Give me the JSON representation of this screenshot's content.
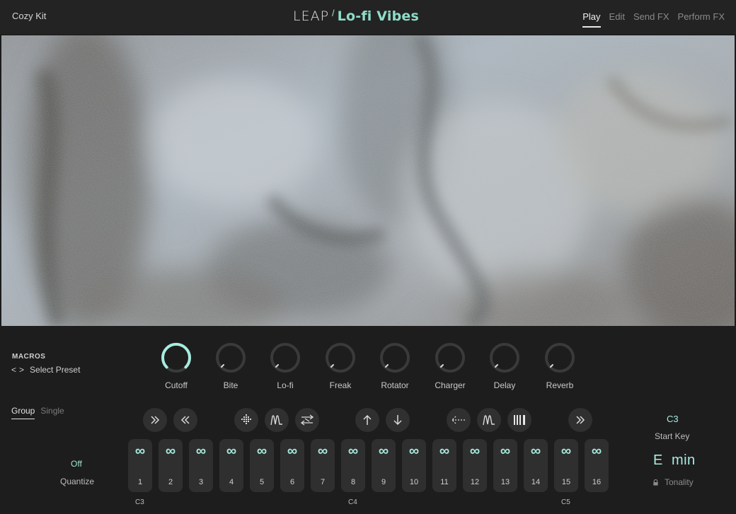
{
  "header": {
    "kit_name": "Cozy Kit",
    "logo_brand": "LEAP",
    "logo_separator": "/",
    "logo_name": "Lo-fi Vibes",
    "tabs": [
      {
        "label": "Play",
        "active": true
      },
      {
        "label": "Edit",
        "active": false
      },
      {
        "label": "Send FX",
        "active": false
      },
      {
        "label": "Perform FX",
        "active": false
      }
    ]
  },
  "artwork": {
    "icon": "blurred-fur-photo"
  },
  "macros": {
    "title": "MACROS",
    "prev_icon": "chevron-left-icon",
    "next_icon": "chevron-right-icon",
    "preset_label": "Select Preset",
    "knobs": [
      {
        "label": "Cutoff",
        "value": 0.9,
        "active": true
      },
      {
        "label": "Bite",
        "value": 0.0,
        "active": false
      },
      {
        "label": "Lo-fi",
        "value": 0.0,
        "active": false
      },
      {
        "label": "Freak",
        "value": 0.0,
        "active": false
      },
      {
        "label": "Rotator",
        "value": 0.0,
        "active": false
      },
      {
        "label": "Charger",
        "value": 0.0,
        "active": false
      },
      {
        "label": "Delay",
        "value": 0.0,
        "active": false
      },
      {
        "label": "Reverb",
        "value": 0.0,
        "active": false
      }
    ]
  },
  "mode_tabs": [
    {
      "label": "Group",
      "active": true
    },
    {
      "label": "Single",
      "active": false
    }
  ],
  "controls": [
    {
      "name": "forward-icon",
      "glyph": "»"
    },
    {
      "name": "reverse-icon",
      "glyph": "«"
    },
    {
      "name": "scatter-icon",
      "glyph": "⬖"
    },
    {
      "name": "envelope-icon",
      "glyph": "ʃ"
    },
    {
      "name": "shuffle-icon",
      "glyph": "⇄"
    },
    {
      "name": "pitch-up-icon",
      "glyph": "↑"
    },
    {
      "name": "pitch-down-icon",
      "glyph": "↓"
    },
    {
      "name": "slice-back-icon",
      "glyph": "⇠"
    },
    {
      "name": "envelope-icon-2",
      "glyph": "ʃ"
    },
    {
      "name": "stutter-icon",
      "glyph": "▥"
    },
    {
      "name": "forward-icon-2",
      "glyph": "»"
    }
  ],
  "pads": [
    {
      "num": "1"
    },
    {
      "num": "2"
    },
    {
      "num": "3"
    },
    {
      "num": "4"
    },
    {
      "num": "5"
    },
    {
      "num": "6"
    },
    {
      "num": "7"
    },
    {
      "num": "8"
    },
    {
      "num": "9"
    },
    {
      "num": "10"
    },
    {
      "num": "11"
    },
    {
      "num": "12"
    },
    {
      "num": "13"
    },
    {
      "num": "14"
    },
    {
      "num": "15"
    },
    {
      "num": "16"
    }
  ],
  "pad_icon": "∞",
  "octaves": [
    "C3",
    "C4",
    "C5"
  ],
  "quantize": {
    "value": "Off",
    "label": "Quantize"
  },
  "start_key": {
    "value": "C3",
    "label": "Start Key"
  },
  "tonality": {
    "value": "E  min",
    "label": "Tonality"
  },
  "colors": {
    "accent": "#a7ece0",
    "background": "#1d1d1d",
    "button": "#303030"
  }
}
